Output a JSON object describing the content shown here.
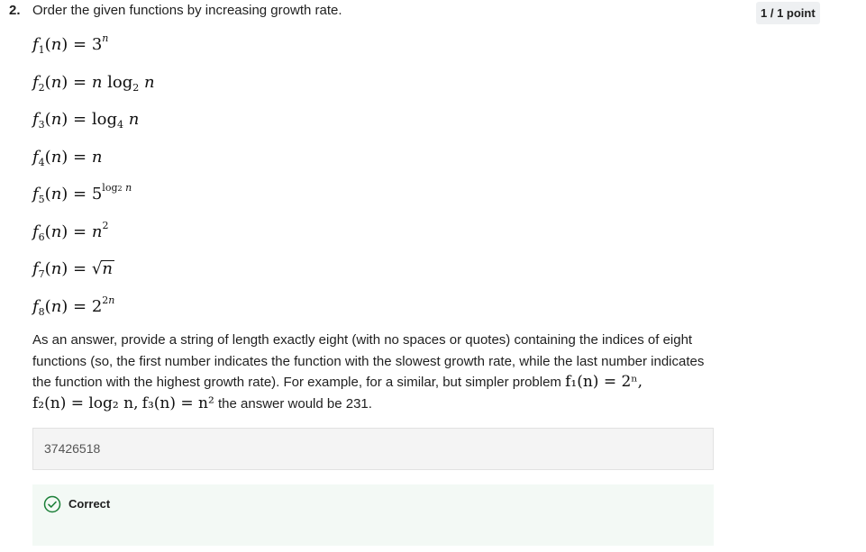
{
  "question": {
    "number": "2.",
    "prompt": "Order the given functions by increasing growth rate.",
    "points": "1 / 1 point"
  },
  "functions": [
    {
      "name": "f",
      "index": "1",
      "rhs": "3ⁿ"
    },
    {
      "name": "f",
      "index": "2",
      "rhs": "n log₂ n"
    },
    {
      "name": "f",
      "index": "3",
      "rhs": "log₄ n"
    },
    {
      "name": "f",
      "index": "4",
      "rhs": "n"
    },
    {
      "name": "f",
      "index": "5",
      "rhs": "5^(log₂ n)"
    },
    {
      "name": "f",
      "index": "6",
      "rhs": "n²"
    },
    {
      "name": "f",
      "index": "7",
      "rhs": "√n"
    },
    {
      "name": "f",
      "index": "8",
      "rhs": "2^(2n)"
    }
  ],
  "instructions": {
    "text": "As an answer, provide a string of length exactly eight (with no spaces or quotes) containing the indices of eight functions (so, the first number indicates the function with the slowest growth rate, while the last number indicates the function with the highest growth rate). For example, for a similar, but simpler problem",
    "example_f1": "f₁(n) = 2ⁿ,",
    "example_f2": "f₂(n) = log₂ n,",
    "example_f3": "f₃(n) = n²",
    "example_tail": "the answer would be 231."
  },
  "answer": {
    "value": "37426518"
  },
  "feedback": {
    "label": "Correct",
    "color": "#1a7f37"
  }
}
